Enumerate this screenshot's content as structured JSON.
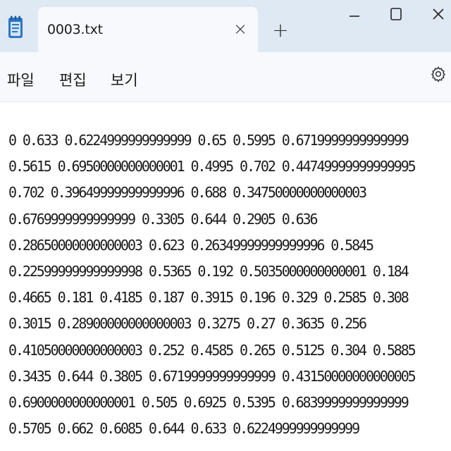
{
  "window": {
    "tab_title": "0003.txt",
    "tab_close_glyph": "×",
    "new_tab_glyph": "+"
  },
  "menu": {
    "file": "파일",
    "edit": "편집",
    "view": "보기"
  },
  "icons": {
    "app": "notepad-icon",
    "settings": "gear-icon",
    "minimize": "minimize-icon",
    "maximize": "maximize-icon",
    "close": "close-icon"
  },
  "editor": {
    "lines": [
      "0 0.633 0.6224999999999999 0.65 0.5995 0.6719999999999999",
      "0.5615 0.6950000000000001 0.4995 0.702 0.44749999999999995",
      "0.702 0.39649999999999996 0.688 0.34750000000000003",
      "0.6769999999999999 0.3305 0.644 0.2905 0.636",
      "0.28650000000000003 0.623 0.26349999999999996 0.5845",
      "0.22599999999999998 0.5365 0.192 0.5035000000000001 0.184",
      "0.4665 0.181 0.4185 0.187 0.3915 0.196 0.329 0.2585 0.308",
      "0.3015 0.28900000000000003 0.3275 0.27 0.3635 0.256",
      "0.41050000000000003 0.252 0.4585 0.265 0.5125 0.304 0.5885",
      "0.3435 0.644 0.3805 0.6719999999999999 0.43150000000000005",
      "0.6900000000000001 0.505 0.6925 0.5395 0.6839999999999999",
      "0.5705 0.662 0.6085 0.644 0.633 0.6224999999999999"
    ]
  },
  "colors": {
    "titlebar_bg": "#dfe9f4",
    "tab_bg": "#f7f9fc",
    "editor_bg": "#ffffff",
    "text": "#1b1b1b",
    "icon_blue": "#2f77c5"
  }
}
